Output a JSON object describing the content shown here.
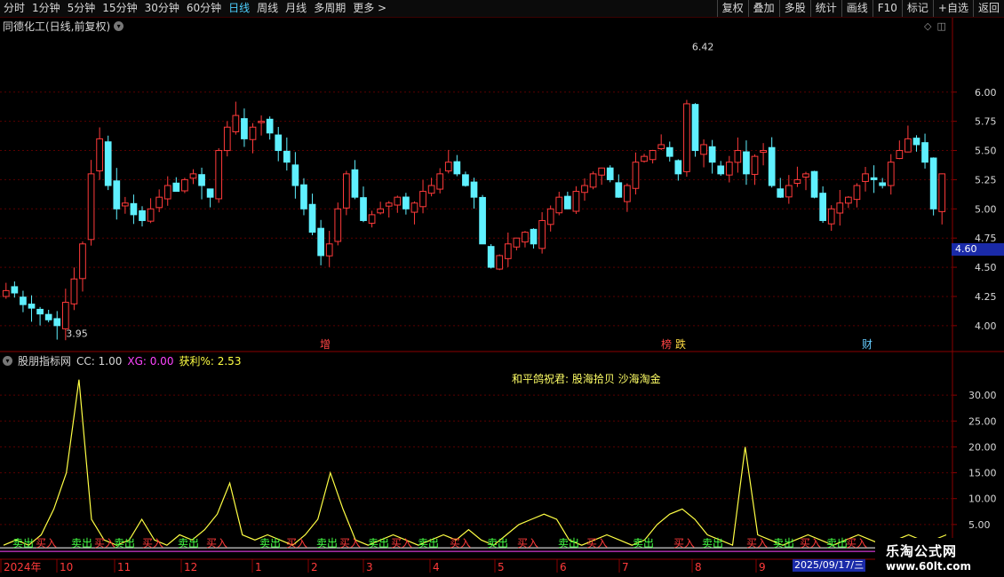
{
  "toolbar": {
    "periods": [
      "分时",
      "1分钟",
      "5分钟",
      "15分钟",
      "30分钟",
      "60分钟",
      "日线",
      "周线",
      "月线",
      "多周期",
      "更多 >"
    ],
    "active_period": "日线",
    "right": [
      "复权",
      "叠加",
      "多股",
      "统计",
      "画线",
      "F10",
      "标记",
      "+自选",
      "返回"
    ]
  },
  "main": {
    "title": "同德化工(日线,前复权)",
    "current_price": "4.60",
    "high_label": "6.42",
    "low_label": "3.95",
    "markers": [
      "增",
      "榜",
      "跌",
      "财"
    ]
  },
  "indicator": {
    "name": "股朋指标网",
    "cc": "CC: 1.00",
    "xg": "XG: 0.00",
    "profit": "获利%: 2.53",
    "blessing": "和平鸽祝君:  股海拾贝  沙海淘金",
    "buy_label": "买入",
    "sell_label": "卖出"
  },
  "xaxis": {
    "labels": [
      "2024年",
      "10",
      "11",
      "12",
      "1",
      "2",
      "3",
      "4",
      "5",
      "6",
      "7",
      "8",
      "9"
    ],
    "current_date": "2025/09/17/三"
  },
  "chart_data": [
    {
      "type": "candlestick",
      "yticks": [
        "6.00",
        "5.75",
        "5.50",
        "5.25",
        "5.00",
        "4.75",
        "4.50",
        "4.25",
        "4.00"
      ],
      "ylim": [
        3.9,
        6.5
      ],
      "close_path": [
        4.3,
        4.28,
        4.18,
        4.15,
        4.1,
        4.05,
        4.0,
        4.2,
        4.4,
        4.7,
        5.3,
        5.6,
        5.2,
        5.0,
        5.05,
        4.95,
        4.9,
        5.0,
        5.1,
        5.2,
        5.15,
        5.25,
        5.3,
        5.2,
        5.1,
        5.5,
        5.7,
        5.8,
        5.6,
        5.7,
        5.75,
        5.65,
        5.5,
        5.4,
        5.2,
        5.0,
        4.8,
        4.6,
        4.7,
        5.0,
        5.3,
        5.1,
        4.9,
        4.95,
        5.0,
        5.05,
        5.1,
        5.0,
        5.05,
        5.15,
        5.2,
        5.3,
        5.4,
        5.3,
        5.2,
        5.1,
        4.7,
        4.5,
        4.6,
        4.7,
        4.75,
        4.8,
        4.7,
        4.9,
        5.0,
        5.1,
        5.0,
        5.15,
        5.2,
        5.3,
        5.35,
        5.25,
        5.1,
        5.2,
        5.4,
        5.45,
        5.5,
        5.55,
        5.45,
        5.3,
        5.9,
        5.5,
        5.55,
        5.4,
        5.3,
        5.4,
        5.5,
        5.3,
        5.45,
        5.5,
        5.2,
        5.1,
        5.2,
        5.25,
        5.3,
        5.1,
        4.9,
        5.0,
        5.05,
        5.1,
        5.2,
        5.3,
        5.25,
        5.2,
        5.4,
        5.5,
        5.6,
        5.55,
        5.4,
        5.0,
        5.3
      ]
    },
    {
      "type": "line",
      "yticks": [
        "30.00",
        "25.00",
        "20.00",
        "15.00",
        "10.00",
        "5.00"
      ],
      "ylim": [
        0,
        35
      ],
      "series": [
        {
          "name": "获利%",
          "values": [
            1,
            2,
            1,
            3,
            8,
            15,
            33,
            6,
            2,
            1,
            2,
            6,
            2,
            1,
            3,
            2,
            4,
            7,
            13,
            3,
            2,
            3,
            2,
            1,
            3,
            6,
            15,
            8,
            2,
            1,
            2,
            3,
            2,
            1,
            2,
            3,
            2,
            4,
            2,
            1,
            3,
            5,
            6,
            7,
            6,
            2,
            1,
            2,
            3,
            2,
            1,
            2,
            5,
            7,
            8,
            6,
            3,
            2,
            1,
            20,
            3,
            2,
            1,
            2,
            3,
            2,
            1,
            2,
            3,
            2,
            1,
            2,
            3,
            2,
            2,
            3
          ]
        }
      ]
    }
  ]
}
